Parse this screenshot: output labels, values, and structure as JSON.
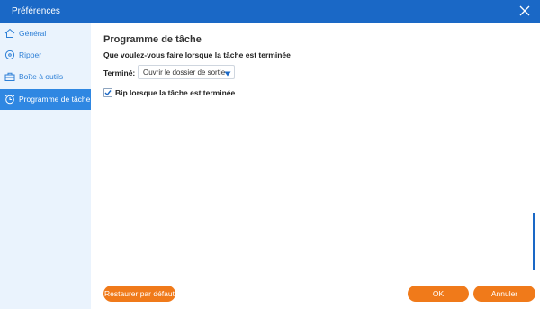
{
  "window": {
    "title": "Préférences",
    "close_icon": "close-icon"
  },
  "sidebar": {
    "items": [
      {
        "label": "Général",
        "icon": "home-icon",
        "active": false
      },
      {
        "label": "Ripper",
        "icon": "disc-icon",
        "active": false
      },
      {
        "label": "Boîte à outils",
        "icon": "toolbox-icon",
        "active": false
      },
      {
        "label": "Programme de tâche",
        "icon": "alarm-clock-icon",
        "active": true
      }
    ]
  },
  "main": {
    "section_title": "Programme de tâche",
    "question": "Que voulez-vous faire lorsque la tâche est terminée",
    "done_label": "Terminé:",
    "done_select": {
      "value": "Ouvrir le dossier de sortie",
      "arrow_icon": "dropdown-arrow-icon"
    },
    "beep_checkbox": {
      "label": "Bip lorsque la tâche est terminée",
      "checked": true
    }
  },
  "buttons": {
    "reset": "Restaurer par défaut",
    "ok": "OK",
    "cancel": "Annuler"
  },
  "colors": {
    "titlebar": "#1a68c6",
    "sidebar_bg": "#eaf3fd",
    "sidebar_active": "#2f87e2",
    "sidebar_text": "#2d7fd6",
    "accent_orange": "#f07a1a"
  }
}
